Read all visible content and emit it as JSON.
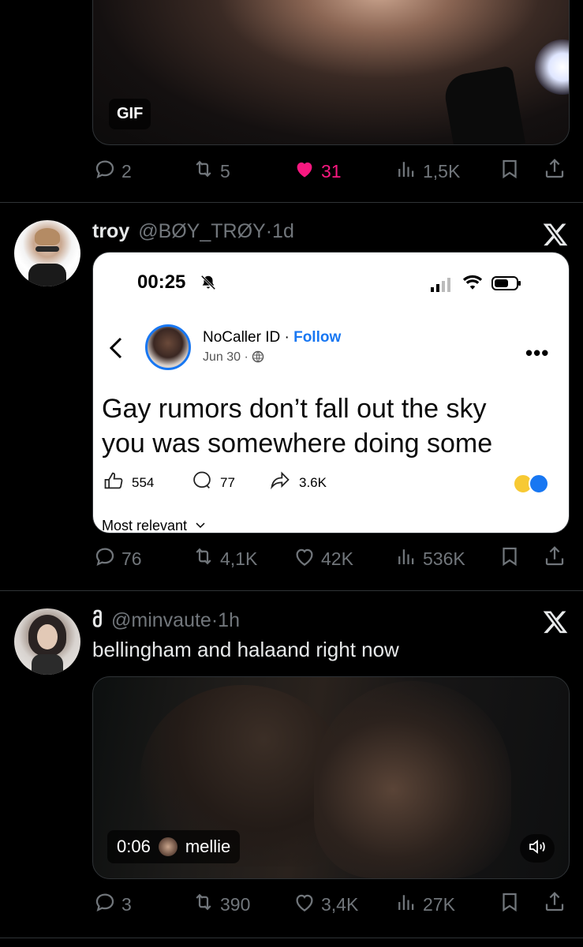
{
  "tweet1": {
    "gif_badge": "GIF",
    "replies": "2",
    "retweets": "5",
    "likes": "31",
    "views": "1,5K",
    "liked": true,
    "like_color": "#f91880"
  },
  "tweet2": {
    "name": "troy",
    "handle": "@BØY_TRØY",
    "time": "1d",
    "embed": {
      "status_time": "00:25",
      "poster_name": "NoCaller ID",
      "follow_label": "Follow",
      "date": "Jun 30",
      "post_text_line1": "Gay rumors don’t fall out the sky",
      "post_text_line2": "you was somewhere doing some",
      "likes": "554",
      "comments": "77",
      "shares": "3.6K",
      "sort_label": "Most relevant"
    },
    "replies": "76",
    "retweets": "4,1K",
    "likes": "42K",
    "views": "536K"
  },
  "tweet3": {
    "name": "მ",
    "handle": "@minvaute",
    "time": "1h",
    "text": "bellingham and halaand right now",
    "video_time": "0:06",
    "video_user": "mellie",
    "replies": "3",
    "retweets": "390",
    "likes": "3,4K",
    "views": "27K"
  },
  "colors": {
    "background": "#000000",
    "muted": "#71767b",
    "link": "#1d9bf0",
    "like": "#f91880"
  }
}
